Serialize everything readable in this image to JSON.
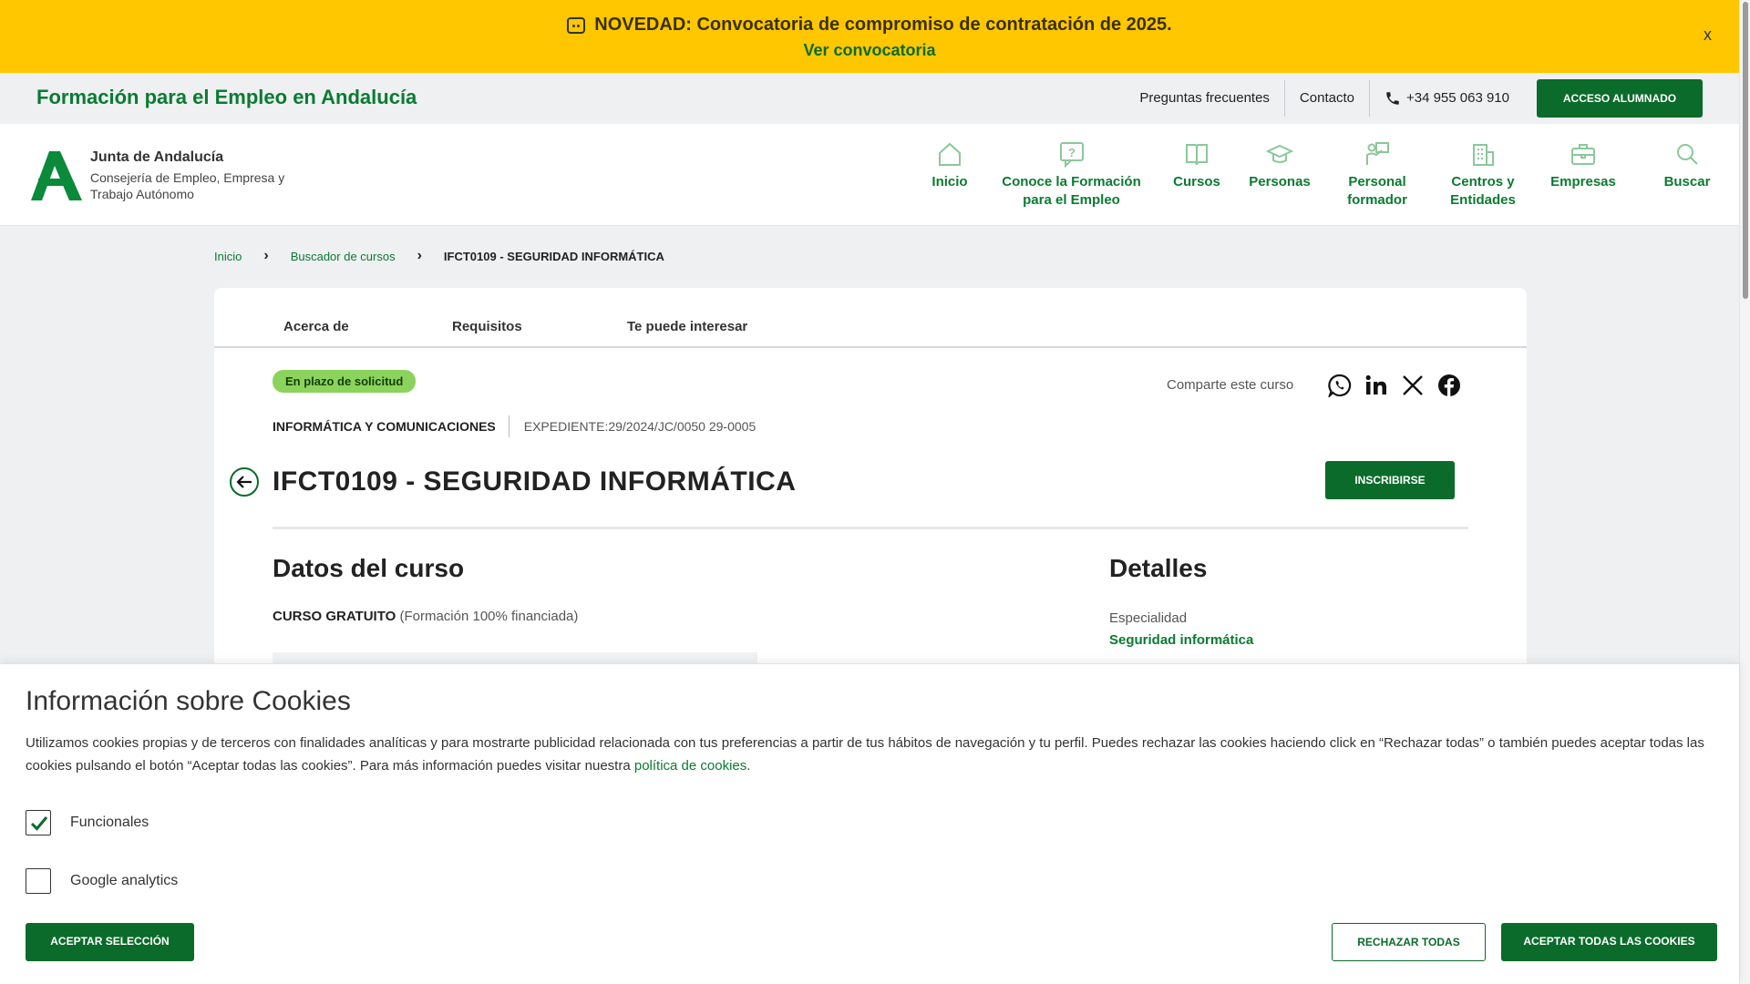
{
  "announcement": {
    "text": "NOVEDAD: Convocatoria de compromiso de contratación de 2025.",
    "link": "Ver convocatoria",
    "close": "x"
  },
  "topbar": {
    "site_title": "Formación para el Empleo en Andalucía",
    "faq": "Preguntas frecuentes",
    "contact": "Contacto",
    "phone": "+34 955 063 910",
    "login": "ACCESO ALUMNADO"
  },
  "header": {
    "org_name": "Junta de Andalucía",
    "org_sub": "Consejería de Empleo, Empresa y Trabajo Autónomo",
    "nav": [
      {
        "label": "Inicio",
        "icon": "home-icon"
      },
      {
        "label": "Conoce la Formación para el Empleo",
        "icon": "question-icon"
      },
      {
        "label": "Cursos",
        "icon": "book-icon"
      },
      {
        "label": "Personas",
        "icon": "graduation-cap-icon"
      },
      {
        "label": "Personal formador",
        "icon": "teacher-icon"
      },
      {
        "label": "Centros y Entidades",
        "icon": "building-icon"
      },
      {
        "label": "Empresas",
        "icon": "briefcase-icon"
      },
      {
        "label": "Buscar",
        "icon": "search-icon"
      }
    ]
  },
  "breadcrumb": [
    "Inicio",
    "Buscador de cursos",
    "IFCT0109 - SEGURIDAD INFORMÁTICA"
  ],
  "course": {
    "tabs": [
      "Acerca de",
      "Requisitos",
      "Te puede interesar"
    ],
    "status": "En plazo de solicitud",
    "share_label": "Comparte este curso",
    "category": "INFORMÁTICA Y COMUNICACIONES",
    "expediente": "EXPEDIENTE:29/2024/JC/0050 29-0005",
    "title": "IFCT0109 - SEGURIDAD INFORMÁTICA",
    "enroll": "INSCRIBIRSE",
    "datos_heading": "Datos del curso",
    "gratuito": "CURSO GRATUITO",
    "gratuito_note": "(Formación 100% financiada)",
    "detalles_heading": "Detalles",
    "especialidad_label": "Especialidad",
    "especialidad_value": "Seguridad informática"
  },
  "cookies": {
    "title": "Información sobre Cookies",
    "text": "Utilizamos cookies propias y de terceros con finalidades analíticas y para mostrarte publicidad relacionada con tus preferencias a partir de tus hábitos de navegación y tu perfil. Puedes rechazar las cookies haciendo click en “Rechazar todas” o también puedes aceptar todas las cookies pulsando el botón “Aceptar todas las cookies”. Para más información puedes visitar nuestra",
    "policy_link": "política de cookies",
    "period": ".",
    "options": [
      {
        "label": "Funcionales",
        "checked": true
      },
      {
        "label": "Google analytics",
        "checked": false
      }
    ],
    "accept_selection": "ACEPTAR SELECCIÓN",
    "reject_all": "RECHAZAR TODAS",
    "accept_all": "ACEPTAR TODAS LAS COOKIES"
  },
  "colors": {
    "brand_green": "#0a6b2a",
    "announcement_yellow": "#ffc700",
    "badge_green": "#8bd35c"
  }
}
